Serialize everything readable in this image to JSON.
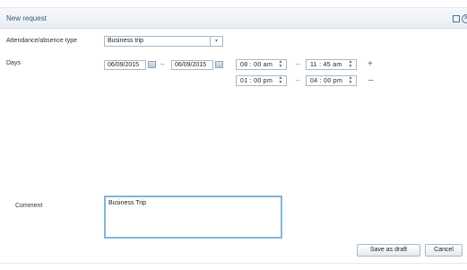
{
  "dialog": {
    "title": "New request",
    "restore_icon": "restore-window-icon",
    "close_icon": "close-icon",
    "close_glyph": "✕"
  },
  "form": {
    "type_label": "Attendance/absence type",
    "type_value": "Business trip",
    "dropdown_glyph": "▾",
    "days_label": "Days",
    "date_from": "06/09/2015",
    "date_to": "06/09/2015",
    "range_separator": "–",
    "time_rows": [
      {
        "start": "08 : 00  am",
        "end": "11 : 45  am",
        "action": "+"
      },
      {
        "start": "01 : 00  pm",
        "end": "04 : 00  pm",
        "action": "–"
      }
    ],
    "spin_up": "▲",
    "spin_down": "▼",
    "comment_label": "Comment",
    "comment_value": "Business Trip"
  },
  "actions": {
    "save_draft": "Save as draft",
    "cancel": "Cancel"
  },
  "colors": {
    "title": "#3a5674",
    "accent_border": "#7fb7da",
    "input_border": "#a8b8c8"
  }
}
